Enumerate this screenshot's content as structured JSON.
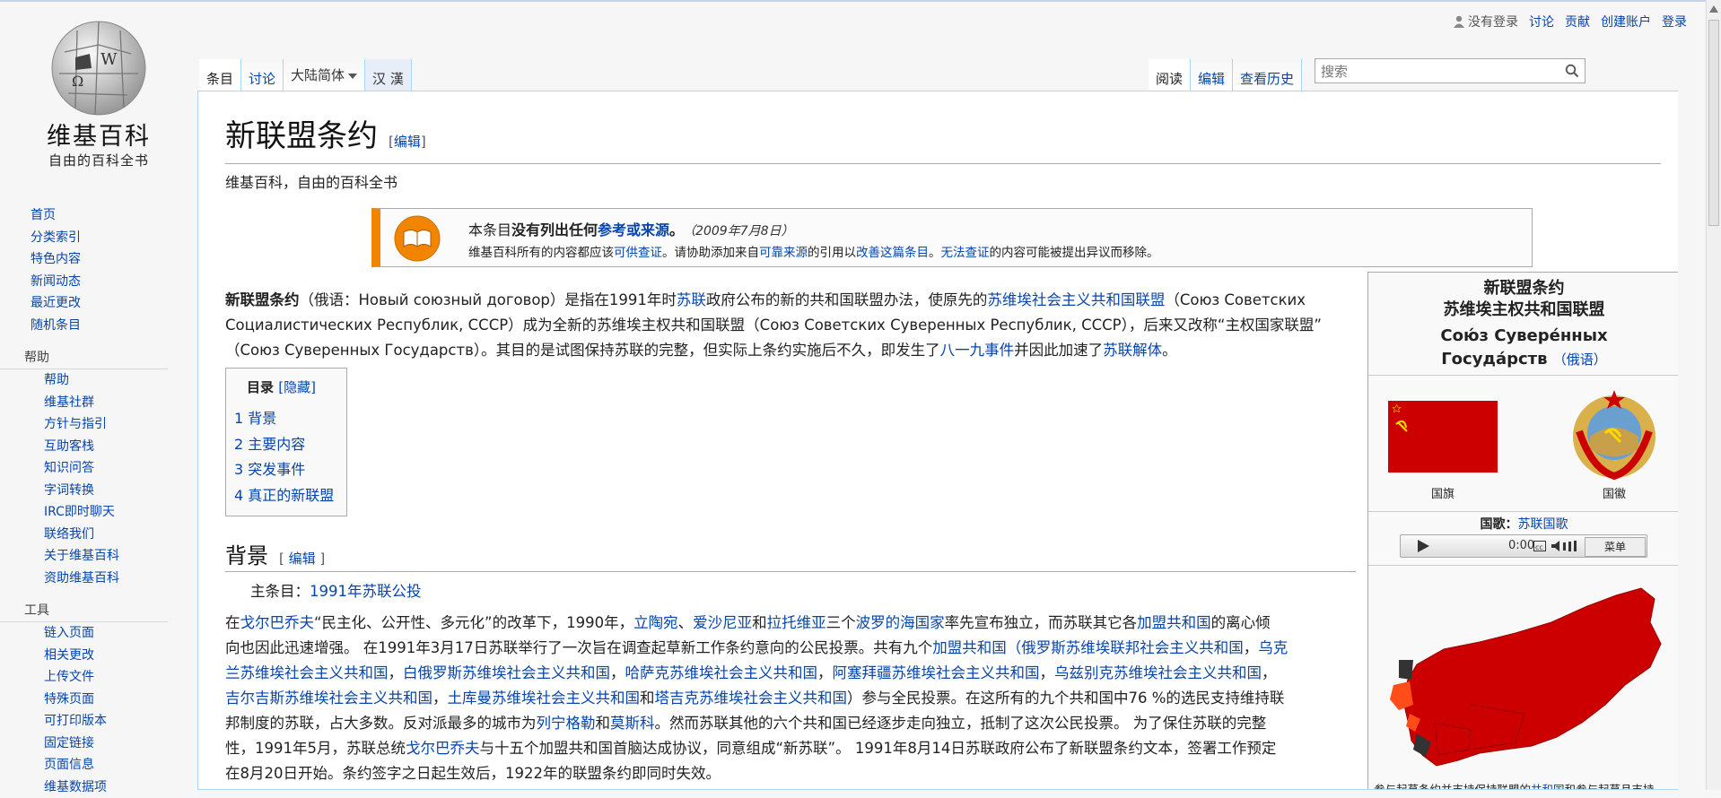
{
  "logo": {
    "title": "维基百科",
    "subtitle": "自由的百科全书",
    "puzzle_letters": [
      "Ω",
      "W"
    ]
  },
  "sidebar": {
    "main": [
      "首页",
      "分类索引",
      "特色内容",
      "新闻动态",
      "最近更改",
      "随机条目"
    ],
    "help_heading": "帮助",
    "help": [
      "帮助",
      "维基社群",
      "方针与指引",
      "互助客栈",
      "知识问答",
      "字词转换",
      "IRC即时聊天",
      "联络我们",
      "关于维基百科",
      "资助维基百科"
    ],
    "tools_heading": "工具",
    "tools": [
      "链入页面",
      "相关更改",
      "上传文件",
      "特殊页面",
      "可打印版本",
      "固定链接",
      "页面信息",
      "维基数据项"
    ]
  },
  "personal": {
    "not_logged_in": "没有登录",
    "talk": "讨论",
    "contributions": "贡献",
    "create_account": "创建账户",
    "login": "登录"
  },
  "tabs": {
    "article": "条目",
    "talk": "讨论",
    "variant": "大陆简体",
    "hanhan": "汉 漢",
    "read": "阅读",
    "edit": "编辑",
    "history": "查看历史"
  },
  "search": {
    "placeholder": "搜索"
  },
  "article": {
    "title": "新联盟条约",
    "edit_label": "编辑",
    "site_sub": "维基百科，自由的百科全书",
    "ambox": {
      "l1_a": "本条目",
      "l1_b": "没有列出任何",
      "l1_c": "参考或来源",
      "l1_d": "。",
      "l1_date": "（2009年7月8日）",
      "l2_a": "维基百科所有的内容都应该",
      "l2_b": "可供查证",
      "l2_c": "。请协助添加来自",
      "l2_d": "可靠来源",
      "l2_e": "的引用以",
      "l2_f": "改善这篇条目",
      "l2_g": "。",
      "l2_h": "无法查证",
      "l2_i": "的内容可能被提出异议而移除。"
    },
    "intro": {
      "bold": "新联盟条约",
      "t1": "（俄语：Новый союзный договор）是指在1991年时",
      "l1": "苏联",
      "t2": "政府公布的新的共和国联盟办法，使原先的",
      "l2": "苏维埃社会主义共和国联盟",
      "t3": "（Союз Советских",
      "line2": "Социалистических Республик, СССР）成为全新的苏维埃主权共和国联盟（Союз Советских Суверенных Республик, СССР），后来又改称“主权国家联盟”",
      "t4": "（Союз Суверенных Государств）。其目的是试图保持苏联的完整，但实际上条约实施后不久，即发生了",
      "l3": "八一九事件",
      "t5": "并因此加速了",
      "l4": "苏联解体",
      "t6": "。"
    },
    "toc": {
      "title": "目录",
      "hide": "[隐藏]",
      "items": [
        "1 背景",
        "2 主要内容",
        "3 突发事件",
        "4 真正的新联盟"
      ]
    },
    "section1": {
      "title": "背景",
      "edit": "编辑",
      "hatnote_label": "主条目：",
      "hatnote_link": "1991年苏联公投"
    },
    "body": {
      "r1": [
        "在",
        "戈尔巴乔夫",
        "“民主化、公开性、多元化”的改革下，1990年，",
        "立陶宛",
        "、",
        "爱沙尼亚",
        "和",
        "拉托维亚",
        "三个",
        "波罗的海国家",
        "率先宣布独立，而苏联其它各",
        "加盟共和国",
        "的离心倾"
      ],
      "r2": "向也因此迅速增强。 在1991年3月17日苏联举行了一次旨在调查起草新工作条约意向的公民投票。共有九个",
      "r2_links": [
        "加盟共和国",
        "（",
        "俄罗斯苏维埃联邦社会主义共和国",
        "，",
        "乌克"
      ],
      "r3": [
        "兰苏维埃社会主义共和国",
        "，",
        "白俄罗斯苏维埃社会主义共和国",
        "，",
        "哈萨克苏维埃社会主义共和国",
        "，",
        "阿塞拜疆苏维埃社会主义共和国",
        "，",
        "乌兹别克苏维埃社会主义共和国",
        "，"
      ],
      "r4": [
        "吉尔吉斯苏维埃社会主义共和国",
        "，",
        "土库曼苏维埃社会主义共和国",
        "和",
        "塔吉克苏维埃社会主义共和国",
        "）参与全民投票。在这所有的九个共和国中76 %的选民支持维持联"
      ],
      "r5": [
        "邦制度的苏联，占大多数。反对派最多的城市为",
        "列宁格勒",
        "和",
        "莫斯科",
        "。然而苏联其他的六个共和国已经逐步走向独立，抵制了这次公民投票。 为了保住苏联的完整"
      ],
      "r6": [
        "性，1991年5月，苏联总统",
        "戈尔巴乔夫",
        "与十五个加盟共和国首脑达成协议，同意组成“新苏联”。 1991年8月14日苏联政府公布了新联盟条约文本，签署工作预定"
      ],
      "r7": "在8月20日开始。条约签字之日起生效后，1922年的联盟条约即同时失效。"
    }
  },
  "infobox": {
    "title1": "新联盟条约",
    "title2": "苏维埃主权共和国联盟",
    "ru1": "Сою́з Сувере́нных",
    "ru2": "Госуда́рств",
    "lang": "（俄语）",
    "flag_caption": "国旗",
    "emblem_caption": "国徽",
    "anthem_label": "国歌：",
    "anthem_link": "苏联国歌",
    "player_time": "0:00",
    "player_menu": "菜单",
    "map_caption_a": "参与起草条约并支持保持联盟的",
    "map_caption_link": "共和国",
    "map_caption_b": "和参与起草且支持"
  },
  "colors": {
    "flag_red": "#cc0000",
    "map_red": "#cc0000",
    "ambox_orange": "#f28500",
    "link": "#0645ad"
  }
}
